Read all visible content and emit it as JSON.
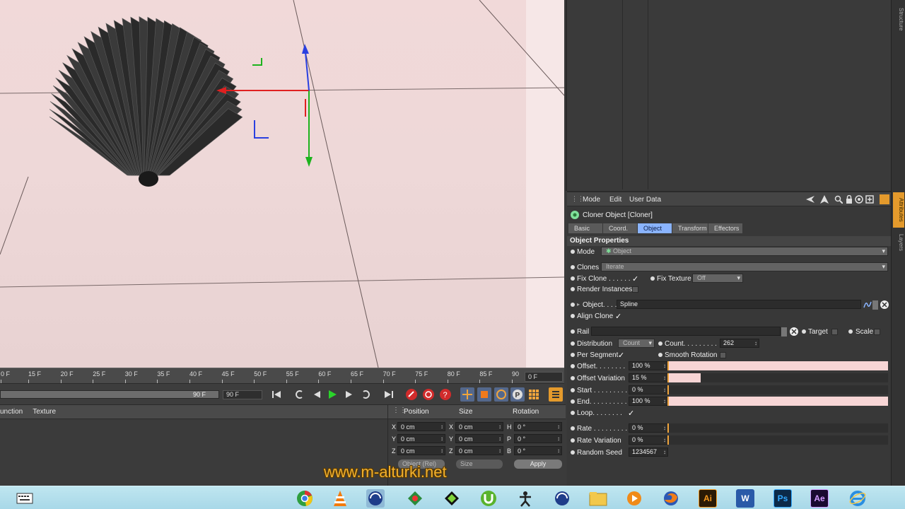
{
  "timeline": {
    "ticks": [
      "0 F",
      "15 F",
      "20 F",
      "25 F",
      "30 F",
      "35 F",
      "40 F",
      "45 F",
      "50 F",
      "55 F",
      "60 F",
      "65 F",
      "70 F",
      "75 F",
      "80 F",
      "85 F",
      "90"
    ],
    "current_frame": "0 F",
    "range_slider_label": "90 F",
    "range_end": "90 F"
  },
  "material_panel": {
    "headers": [
      "unction",
      "Texture"
    ]
  },
  "coordinates": {
    "headers": {
      "position": "Position",
      "size": "Size",
      "rotation": "Rotation"
    },
    "rows": [
      {
        "axis": "X",
        "pos": "0 cm",
        "size_axis": "X",
        "size": "0 cm",
        "rot_axis": "H",
        "rot": "0 °"
      },
      {
        "axis": "Y",
        "pos": "0 cm",
        "size_axis": "Y",
        "size": "0 cm",
        "rot_axis": "P",
        "rot": "0 °"
      },
      {
        "axis": "Z",
        "pos": "0 cm",
        "size_axis": "Z",
        "size": "0 cm",
        "rot_axis": "B",
        "rot": "0 °"
      }
    ],
    "mode_dropdown": "Object (Rel)",
    "size_dropdown": "Size",
    "apply_label": "Apply"
  },
  "side_tabs": {
    "structure": "Structure",
    "attributes": "Attributes",
    "layers": "Layers"
  },
  "attributes": {
    "menu": {
      "mode": "Mode",
      "edit": "Edit",
      "user_data": "User Data"
    },
    "object_title": "Cloner Object [Cloner]",
    "tabs": [
      "Basic",
      "Coord.",
      "Object",
      "Transform",
      "Effectors"
    ],
    "active_tab": "Object",
    "section_title": "Object Properties",
    "mode": {
      "label": "Mode",
      "value": "Object"
    },
    "clones": {
      "label": "Clones",
      "value": "Iterate"
    },
    "fix_clone": {
      "label": "Fix Clone . . . . . .",
      "checked": "✓"
    },
    "fix_texture": {
      "label": "Fix Texture",
      "value": "Off"
    },
    "render_instances": {
      "label": "Render Instances"
    },
    "object": {
      "label": "Object. . . .",
      "value": "Spline"
    },
    "align_clone": {
      "label": "Align Clone",
      "checked": "✓"
    },
    "rail": {
      "label": "Rail",
      "value": ""
    },
    "target": {
      "label": "Target"
    },
    "scale": {
      "label": "Scale"
    },
    "distribution": {
      "label": "Distribution",
      "value": "Count"
    },
    "count": {
      "label": "Count. . . . . . . . .",
      "value": "262"
    },
    "per_segment": {
      "label": "Per Segment",
      "checked": "✓"
    },
    "smooth_rotation": {
      "label": "Smooth Rotation"
    },
    "offset": {
      "label": "Offset. . . . . . . .",
      "value": "100 %",
      "fraction": 1.0
    },
    "offset_variation": {
      "label": "Offset Variation",
      "value": "15 %",
      "fraction": 0.15
    },
    "start": {
      "label": "Start . . . . . . . . .",
      "value": "0 %",
      "fraction": 0.0
    },
    "end": {
      "label": "End. . . . . . . . . .",
      "value": "100 %",
      "fraction": 1.0
    },
    "loop": {
      "label": "Loop. . . . . . . .",
      "checked": "✓"
    },
    "rate": {
      "label": "Rate . . . . . . . . .",
      "value": "0 %",
      "fraction": 0.0
    },
    "rate_variation": {
      "label": "Rate Variation",
      "value": "0 %",
      "fraction": 0.0
    },
    "random_seed": {
      "label": "Random Seed",
      "value": "1234567"
    }
  },
  "watermark": "www.m-alturki.net",
  "taskbar": {
    "icons": [
      "keyboard-icon",
      "chrome-icon",
      "vlc-icon",
      "cinema4d-icon",
      "corel-icon",
      "corel-draw-icon",
      "utorrent-icon",
      "zbrush-icon",
      "cinema4d-alt-icon",
      "folder-icon",
      "media-player-icon",
      "firefox-icon",
      "illustrator-icon",
      "word-icon",
      "photoshop-icon",
      "after-effects-icon",
      "internet-explorer-icon"
    ],
    "labels": {
      "illustrator": "Ai",
      "word": "W",
      "photoshop": "Ps",
      "after_effects": "Ae"
    }
  },
  "colors": {
    "accent_orange": "#e49a2c",
    "tab_active": "#8ab4ff",
    "viewport_bg": "#eed8d8",
    "slider_fill": "#f7d5d5"
  }
}
